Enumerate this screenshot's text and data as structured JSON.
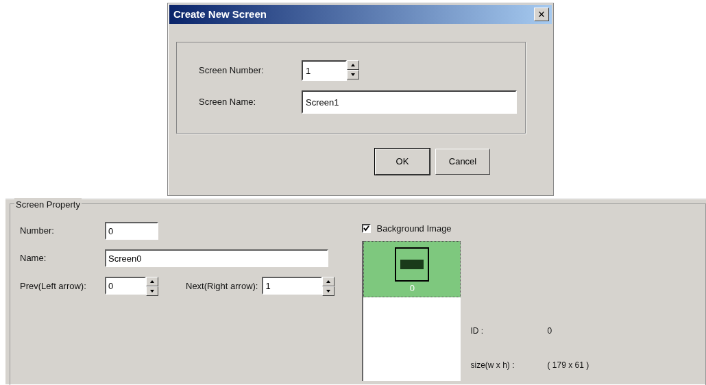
{
  "dialog": {
    "title": "Create New Screen",
    "close": "×",
    "fields": [
      {
        "label": "Screen Number:",
        "value": "1",
        "kind": "spin"
      },
      {
        "label": "Screen Name:",
        "value": "Screen1",
        "kind": "text"
      }
    ],
    "buttons": [
      {
        "label": "OK",
        "default": true
      },
      {
        "label": "Cancel",
        "default": false
      }
    ]
  },
  "screen_property": {
    "title": "Screen Property",
    "number": {
      "label": "Number:",
      "value": "0"
    },
    "name": {
      "label": "Name:",
      "value": "Screen0"
    },
    "prev": {
      "label": "Prev(Left arrow):",
      "value": "0"
    },
    "next": {
      "label": "Next(Right arrow):",
      "value": "1"
    },
    "background_image": {
      "label": "Background Image",
      "checked": true
    },
    "thumbnails": [
      {
        "caption": "0",
        "selected": true
      }
    ],
    "id": {
      "label": "ID :",
      "value": "0"
    },
    "size": {
      "label": "size(w x h) :",
      "value": "( 179 x 61 )"
    }
  }
}
